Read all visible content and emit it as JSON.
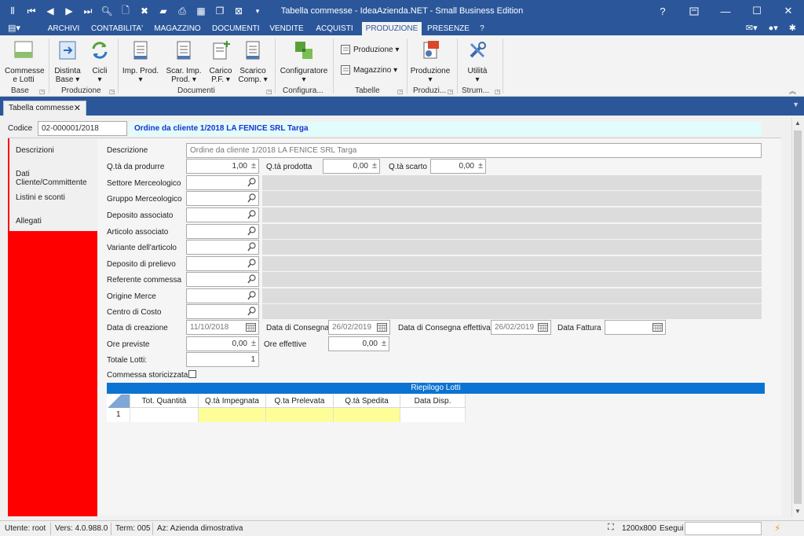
{
  "window": {
    "title": "Tabella commesse - IdeaAzienda.NET - Small Business Edition",
    "help": "?",
    "restore_icon": "restore-down-icon",
    "minimize": "—",
    "maximize": "☐",
    "close": "✕"
  },
  "qat_icons": [
    "app-icon",
    "first-record-icon",
    "prev-record-icon",
    "next-record-icon",
    "last-record-icon",
    "search-icon",
    "new-document-icon",
    "delete-icon",
    "folder-icon",
    "print-icon",
    "calc-icon",
    "copy-icon",
    "excel-icon",
    "customize-qat-icon"
  ],
  "menu": {
    "tabs": [
      "ARCHIVI",
      "CONTABILITA'",
      "MAGAZZINO",
      "DOCUMENTI",
      "VENDITE",
      "ACQUISTI",
      "PRODUZIONE",
      "PRESENZE",
      "?"
    ],
    "active": "PRODUZIONE"
  },
  "ribbon": {
    "commesse": "Commesse e Lotti",
    "commesse_l1": "Commesse",
    "commesse_l2": "e Lotti",
    "distinta_l1": "Distinta",
    "distinta_l2": "Base ▾",
    "cicli_l1": "Cicli",
    "cicli_l2": "▾",
    "imp_prod_l1": "Imp. Prod.",
    "imp_prod_l2": "▾",
    "scar_l1": "Scar. Imp.",
    "scar_l2": "Prod. ▾",
    "carico_l1": "Carico",
    "carico_l2": "P.F. ▾",
    "scarico_l1": "Scarico",
    "scarico_l2": "Comp. ▾",
    "configuratore": "Configuratore",
    "config_arrow": "▾",
    "produzione_small": "Produzione ▾",
    "magazzino_small": "Magazzino ▾",
    "produzione_big": "Produzione",
    "produzione_big_arrow": "▾",
    "utilita": "Utilità",
    "utilita_arrow": "▾",
    "groups": {
      "base": "Base",
      "produzione": "Produzione",
      "documenti": "Documenti",
      "configura": "Configura...",
      "tabelle": "Tabelle",
      "produzi": "Produzi...",
      "strum": "Strum..."
    }
  },
  "doc_tab": {
    "label": "Tabella commesse",
    "close": "✕"
  },
  "header": {
    "codice_label": "Codice",
    "codice_value": "02-000001/2018",
    "title": "Ordine da cliente 1/2018 LA FENICE SRL Targa"
  },
  "side_tabs": [
    "Descrizioni",
    "Dati Cliente/Committente",
    "Listini e sconti",
    "Allegati"
  ],
  "form": {
    "descrizione_label": "Descrizione",
    "descrizione_value": "Ordine da cliente 1/2018 LA FENICE SRL Targa",
    "qta_prod_label": "Q.tà da produrre",
    "qta_prod_value": "1,00",
    "qta_prodotta_label": "Q.tà prodotta",
    "qta_prodotta_value": "0,00",
    "qta_scarto_label": "Q.tà scarto",
    "qta_scarto_value": "0,00",
    "lookups": [
      "Settore Merceologico",
      "Gruppo Merceologico",
      "Deposito associato",
      "Articolo associato",
      "Variante dell'articolo",
      "Deposito di prelievo",
      "Referente commessa",
      "Origine Merce",
      "Centro di Costo"
    ],
    "data_creazione_label": "Data di creazione",
    "data_creazione_value": "11/10/2018",
    "data_consegna_label": "Data di Consegna",
    "data_consegna_value": "26/02/2019",
    "data_consegna_eff_label": "Data di Consegna effettiva",
    "data_consegna_eff_value": "26/02/2019",
    "data_fattura_label": "Data Fattura",
    "data_fattura_value": "",
    "ore_previste_label": "Ore previste",
    "ore_previste_value": "0,00",
    "ore_effettive_label": "Ore effettive",
    "ore_effettive_value": "0,00",
    "totale_lotti_label": "Totale Lotti:",
    "totale_lotti_value": "1",
    "storicizzata_label": "Commessa storicizzata",
    "storicizzata_checked": false
  },
  "riepilogo": {
    "title": "Riepilogo Lotti",
    "columns": [
      "Tot. Quantità",
      "Q.tà Impegnata",
      "Q.ta Prelevata",
      "Q.tà Spedita",
      "Data Disp."
    ],
    "rows": [
      {
        "num": "1",
        "cells": [
          "",
          "",
          "",
          "",
          ""
        ]
      }
    ]
  },
  "status": {
    "utente": "Utente: root",
    "vers": "Vers: 4.0.988.0",
    "term": "Term: 005",
    "az": "Az: Azienda dimostrativa",
    "resolution": "1200x800",
    "esegui": "Esegui"
  },
  "colors": {
    "accent": "#2b579a",
    "title_blue": "#1a33cc",
    "side_red": "#ff0000",
    "riepilogo_bar": "#0b74d2",
    "highlight_yellow": "#fefe99",
    "header_cyan": "#e2fbfb"
  }
}
